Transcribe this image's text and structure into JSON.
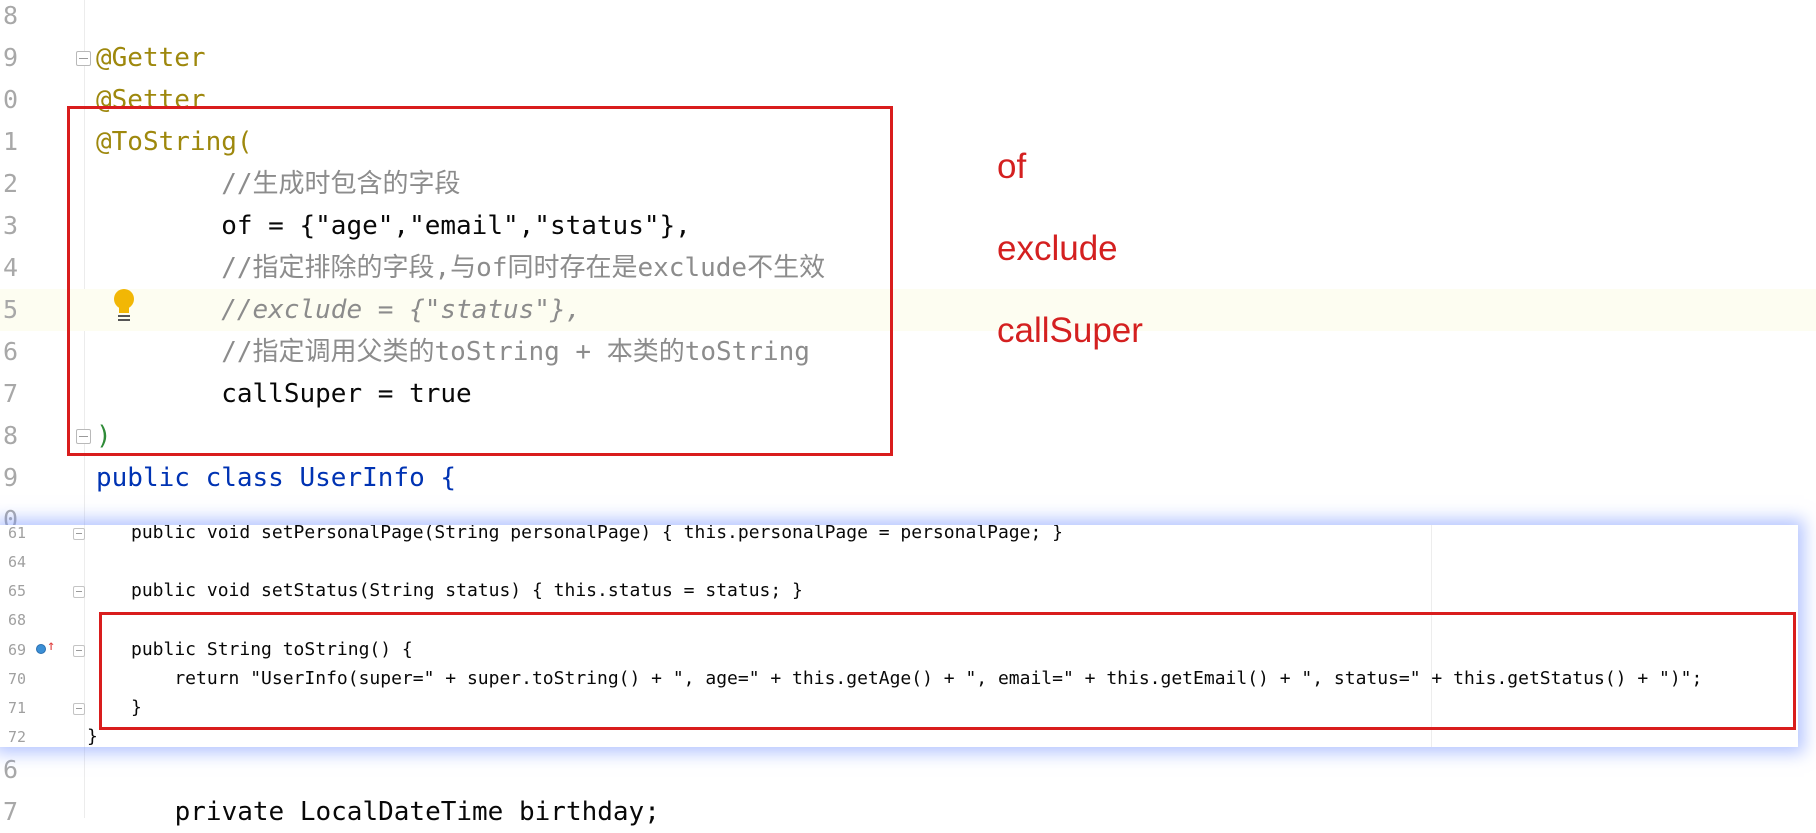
{
  "editor": {
    "lines": [
      {
        "num": "8",
        "code": ""
      },
      {
        "num": "9",
        "code": "@Getter"
      },
      {
        "num": "0",
        "code": "@Setter"
      },
      {
        "num": "1",
        "code": "@ToString("
      },
      {
        "num": "2",
        "code": "        //生成时包含的字段"
      },
      {
        "num": "3",
        "code": "        of = {\"age\",\"email\",\"status\"},"
      },
      {
        "num": "4",
        "code": "        //指定排除的字段,与of同时存在是exclude不生效"
      },
      {
        "num": "5",
        "code": "        //exclude = {\"status\"},"
      },
      {
        "num": "6",
        "code": "        //指定调用父类的toString + 本类的toString"
      },
      {
        "num": "7",
        "code": "        callSuper = true"
      },
      {
        "num": "8",
        "code": ")"
      },
      {
        "num": "9",
        "code": "public class UserInfo {"
      },
      {
        "num": "0",
        "code": ""
      }
    ],
    "bottom_lines": [
      {
        "num": "6",
        "code": ""
      },
      {
        "num": "7",
        "code": "    private LocalDateTime birthday;"
      }
    ]
  },
  "annotations": {
    "items": [
      "of",
      "exclude",
      "callSuper"
    ],
    "color": "#d42020"
  },
  "overlay": {
    "lines": [
      {
        "num": "61",
        "code": "public void setPersonalPage(String personalPage) { this.personalPage = personalPage; }"
      },
      {
        "num": "64",
        "code": ""
      },
      {
        "num": "65",
        "code": "public void setStatus(String status) { this.status = status; }"
      },
      {
        "num": "68",
        "code": ""
      },
      {
        "num": "69",
        "code": "public String toString() {"
      },
      {
        "num": "70",
        "code": "    return \"UserInfo(super=\" + super.toString() + \", age=\" + this.getAge() + \", email=\" + this.getEmail() + \", status=\" + this.getStatus() + \")\";"
      },
      {
        "num": "71",
        "code": "}"
      },
      {
        "num": "72",
        "code": "}"
      }
    ]
  },
  "colors": {
    "highlight_box": "#d91d1d",
    "overlay_glow": "#7896ff",
    "keyword": "#0033b3",
    "string": "#067d17",
    "annotation": "#9e880d",
    "comment": "#8c8c8c"
  },
  "icons": [
    "intention-bulb-icon",
    "fold-marker-icon",
    "override-method-icon"
  ]
}
